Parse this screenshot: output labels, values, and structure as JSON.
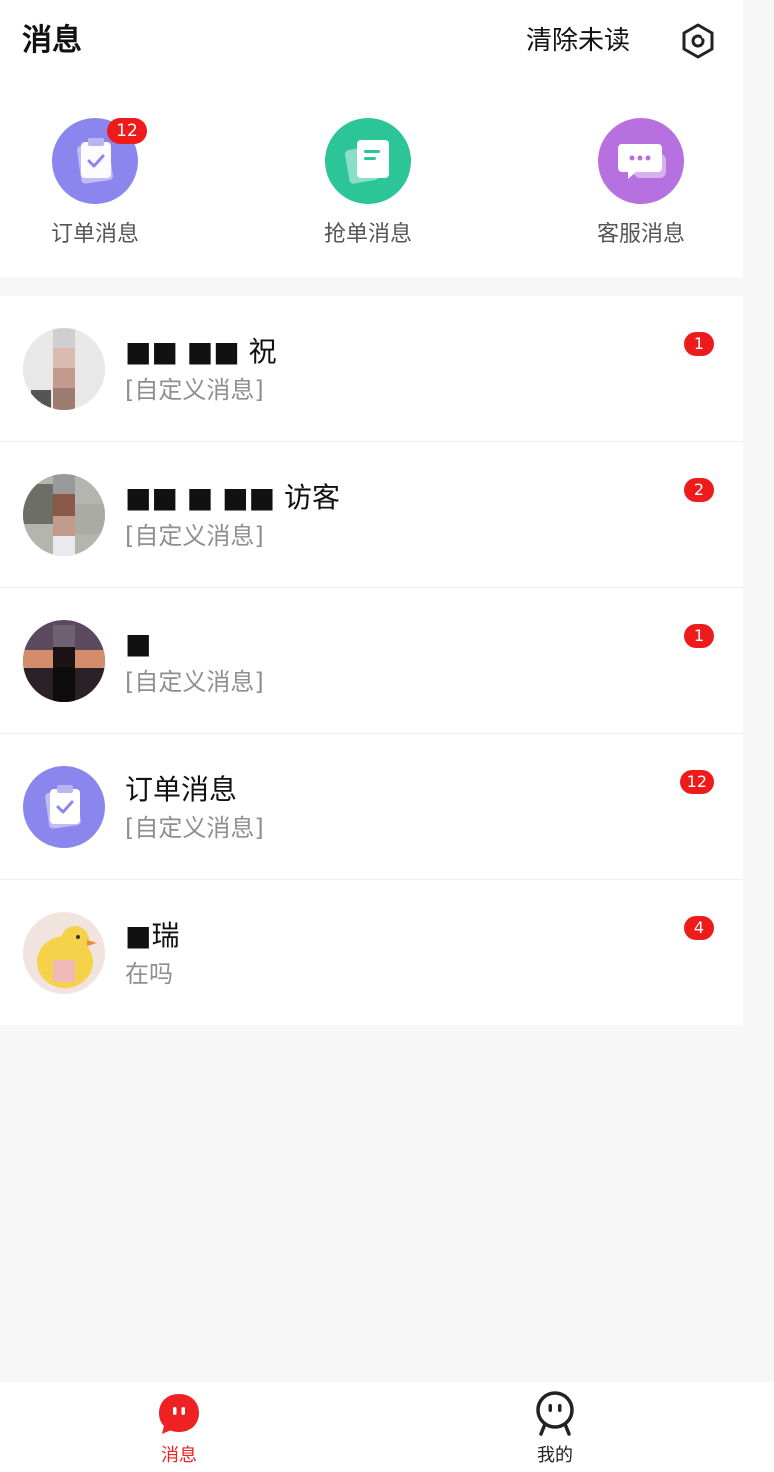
{
  "header": {
    "title": "消息",
    "clear_unread": "清除未读",
    "settings_icon": "hexagon-settings-icon"
  },
  "quick_actions": [
    {
      "label": "订单消息",
      "badge": "12",
      "color": "#8b86ee",
      "icon": "clipboard-check-icon"
    },
    {
      "label": "抢单消息",
      "badge": "",
      "color": "#2cc597",
      "icon": "document-stack-icon"
    },
    {
      "label": "客服消息",
      "badge": "",
      "color": "#b770e0",
      "icon": "chat-bubbles-icon"
    }
  ],
  "conversations": [
    {
      "name": "■■ ■■ 祝",
      "preview": "[自定义消息]",
      "badge": "1"
    },
    {
      "name": "■■ ■ ■■ 访客",
      "preview": "[自定义消息]",
      "badge": "2"
    },
    {
      "name": "■",
      "preview": "[自定义消息]",
      "badge": "1"
    },
    {
      "name": "订单消息",
      "preview": "[自定义消息]",
      "badge": "12"
    },
    {
      "name": "■瑞",
      "preview": "在吗",
      "badge": "4"
    }
  ],
  "tabbar": {
    "messages_label": "消息",
    "mine_label": "我的",
    "active_color": "#ee2222"
  }
}
